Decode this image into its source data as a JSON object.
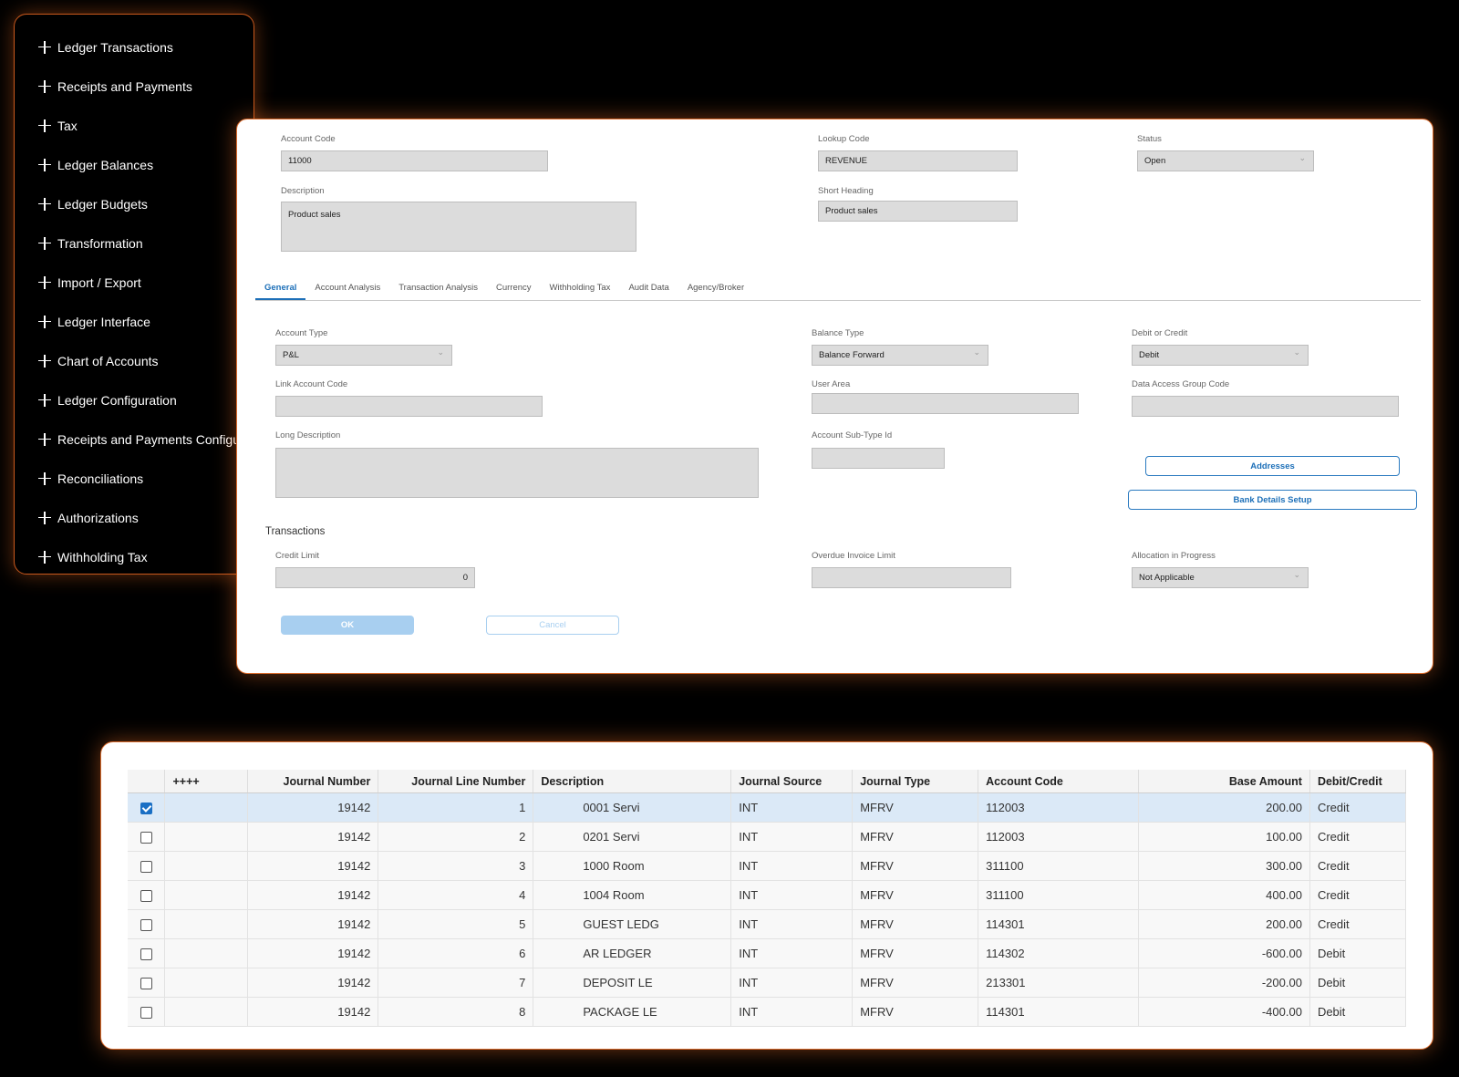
{
  "sidebar": {
    "items": [
      {
        "label": "Ledger Transactions"
      },
      {
        "label": "Receipts and Payments"
      },
      {
        "label": "Tax"
      },
      {
        "label": "Ledger Balances"
      },
      {
        "label": "Ledger Budgets"
      },
      {
        "label": "Transformation"
      },
      {
        "label": "Import / Export"
      },
      {
        "label": "Ledger Interface"
      },
      {
        "label": "Chart of Accounts"
      },
      {
        "label": "Ledger Configuration"
      },
      {
        "label": "Receipts and Payments Configurati"
      },
      {
        "label": "Reconciliations"
      },
      {
        "label": "Authorizations"
      },
      {
        "label": "Withholding Tax"
      }
    ]
  },
  "form": {
    "account_code": {
      "label": "Account Code",
      "value": "11000"
    },
    "lookup_code": {
      "label": "Lookup Code",
      "value": "REVENUE"
    },
    "status": {
      "label": "Status",
      "value": "Open"
    },
    "description": {
      "label": "Description",
      "value": "Product sales"
    },
    "short_heading": {
      "label": "Short Heading",
      "value": "Product sales"
    },
    "tabs": [
      "General",
      "Account Analysis",
      "Transaction Analysis",
      "Currency",
      "Withholding Tax",
      "Audit Data",
      "Agency/Broker"
    ],
    "account_type": {
      "label": "Account Type",
      "value": "P&L"
    },
    "balance_type": {
      "label": "Balance Type",
      "value": "Balance Forward"
    },
    "debit_or_credit": {
      "label": "Debit or Credit",
      "value": "Debit"
    },
    "link_account_code": {
      "label": "Link Account Code",
      "value": ""
    },
    "user_area": {
      "label": "User Area",
      "value": ""
    },
    "data_access_group_code": {
      "label": "Data Access Group Code",
      "value": ""
    },
    "long_description": {
      "label": "Long Description",
      "value": ""
    },
    "account_sub_type_id": {
      "label": "Account Sub-Type Id",
      "value": ""
    },
    "addresses_button": "Addresses",
    "bank_details_button": "Bank Details Setup",
    "transactions_title": "Transactions",
    "credit_limit": {
      "label": "Credit Limit",
      "value": "0"
    },
    "overdue_invoice_limit": {
      "label": "Overdue Invoice Limit",
      "value": ""
    },
    "allocation_in_progress": {
      "label": "Allocation in Progress",
      "value": "Not Applicable"
    },
    "ok_button": "OK",
    "cancel_button": "Cancel"
  },
  "table": {
    "columns": [
      "",
      "++++",
      "Journal Number",
      "Journal Line Number",
      "Description",
      "Journal Source",
      "Journal Type",
      "Account Code",
      "Base Amount",
      "Debit/Credit"
    ],
    "rows": [
      {
        "selected": true,
        "journal_number": "19142",
        "line": "1",
        "description": "0001 Servi",
        "source": "INT",
        "type": "MFRV",
        "account_code": "112003",
        "base_amount": "200.00",
        "dc": "Credit"
      },
      {
        "selected": false,
        "journal_number": "19142",
        "line": "2",
        "description": "0201 Servi",
        "source": "INT",
        "type": "MFRV",
        "account_code": "112003",
        "base_amount": "100.00",
        "dc": "Credit"
      },
      {
        "selected": false,
        "journal_number": "19142",
        "line": "3",
        "description": "1000 Room",
        "source": "INT",
        "type": "MFRV",
        "account_code": "311100",
        "base_amount": "300.00",
        "dc": "Credit"
      },
      {
        "selected": false,
        "journal_number": "19142",
        "line": "4",
        "description": "1004 Room",
        "source": "INT",
        "type": "MFRV",
        "account_code": "311100",
        "base_amount": "400.00",
        "dc": "Credit"
      },
      {
        "selected": false,
        "journal_number": "19142",
        "line": "5",
        "description": "GUEST LEDG",
        "source": "INT",
        "type": "MFRV",
        "account_code": "114301",
        "base_amount": "200.00",
        "dc": "Credit"
      },
      {
        "selected": false,
        "journal_number": "19142",
        "line": "6",
        "description": "AR LEDGER",
        "source": "INT",
        "type": "MFRV",
        "account_code": "114302",
        "base_amount": "-600.00",
        "dc": "Debit"
      },
      {
        "selected": false,
        "journal_number": "19142",
        "line": "7",
        "description": "DEPOSIT LE",
        "source": "INT",
        "type": "MFRV",
        "account_code": "213301",
        "base_amount": "-200.00",
        "dc": "Debit"
      },
      {
        "selected": false,
        "journal_number": "19142",
        "line": "8",
        "description": "PACKAGE LE",
        "source": "INT",
        "type": "MFRV",
        "account_code": "114301",
        "base_amount": "-400.00",
        "dc": "Debit"
      }
    ]
  },
  "colors": {
    "accent_border": "#d96a2b",
    "primary": "#1c6fb8",
    "selected_row": "#dbe9f7"
  }
}
